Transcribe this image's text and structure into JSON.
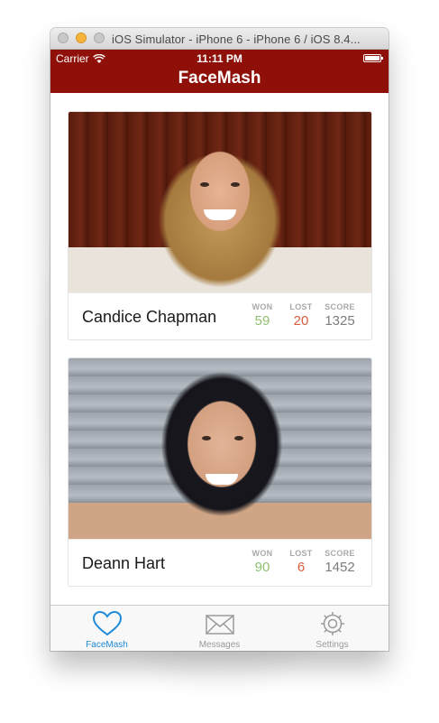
{
  "window": {
    "title": "iOS Simulator - iPhone 6 - iPhone 6 / iOS 8.4..."
  },
  "status_bar": {
    "carrier": "Carrier",
    "time": "11:11 PM"
  },
  "nav": {
    "title": "FaceMash"
  },
  "colors": {
    "brand": "#8e1008",
    "won": "#8fbf6f",
    "lost": "#dd5c3c",
    "tab_active": "#1e8ad8"
  },
  "cards": [
    {
      "name": "Candice Chapman",
      "won_label": "WON",
      "won": "59",
      "lost_label": "LOST",
      "lost": "20",
      "score_label": "SCORE",
      "score": "1325"
    },
    {
      "name": "Deann Hart",
      "won_label": "WON",
      "won": "90",
      "lost_label": "LOST",
      "lost": "6",
      "score_label": "SCORE",
      "score": "1452"
    }
  ],
  "tabs": [
    {
      "label": "FaceMash",
      "icon": "heart-icon",
      "active": true
    },
    {
      "label": "Messages",
      "icon": "envelope-icon",
      "active": false
    },
    {
      "label": "Settings",
      "icon": "gear-icon",
      "active": false
    }
  ]
}
